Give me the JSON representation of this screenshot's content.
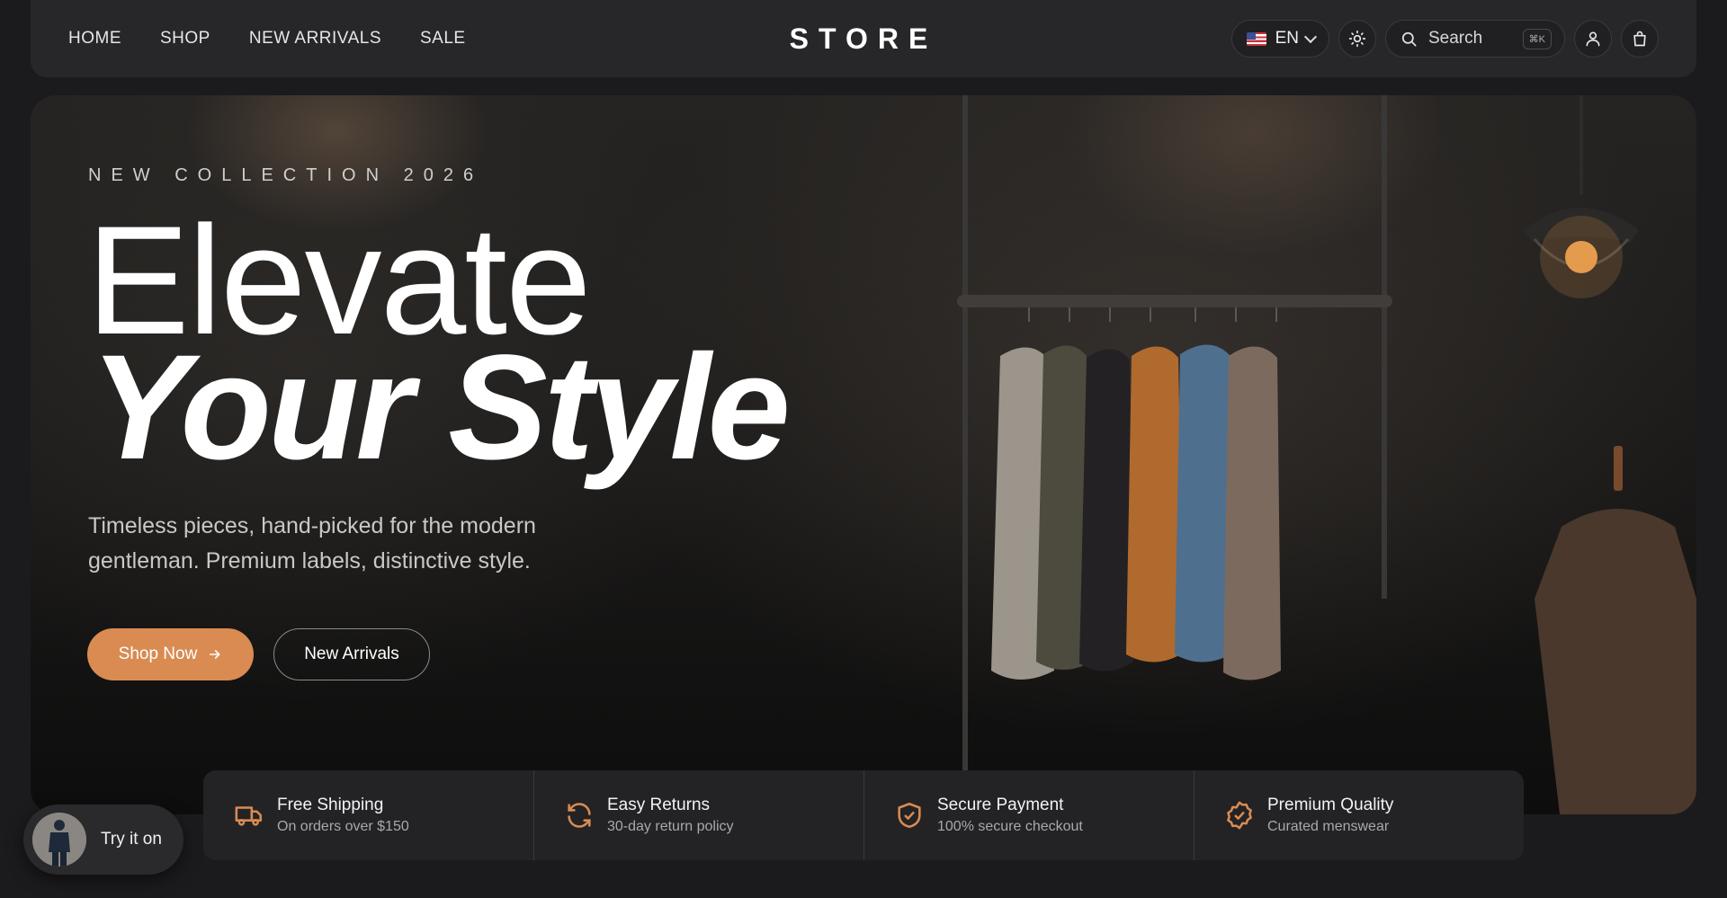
{
  "nav": {
    "links": [
      "HOME",
      "SHOP",
      "NEW ARRIVALS",
      "SALE"
    ],
    "logo": "STORE",
    "language": "EN",
    "search_label": "Search",
    "search_shortcut": "⌘K"
  },
  "hero": {
    "eyebrow": "NEW COLLECTION 2026",
    "headline_line1": "Elevate",
    "headline_line2": "Your Style",
    "subtext": "Timeless pieces, hand-picked for the modern gentleman. Premium labels, distinctive style.",
    "primary_button": "Shop Now",
    "secondary_button": "New Arrivals"
  },
  "features": [
    {
      "title": "Free Shipping",
      "desc": "On orders over $150",
      "icon": "truck-icon"
    },
    {
      "title": "Easy Returns",
      "desc": "30-day return policy",
      "icon": "refresh-icon"
    },
    {
      "title": "Secure Payment",
      "desc": "100% secure checkout",
      "icon": "shield-check-icon"
    },
    {
      "title": "Premium Quality",
      "desc": "Curated menswear",
      "icon": "badge-check-icon"
    }
  ],
  "try_on": {
    "label": "Try it on"
  },
  "colors": {
    "accent": "#d98b52",
    "background": "#1b1b1d",
    "nav": "#27272a"
  }
}
